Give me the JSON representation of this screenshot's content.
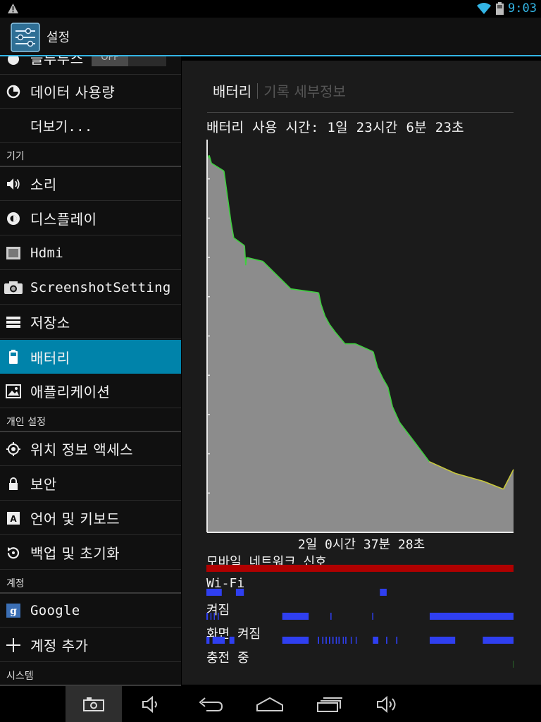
{
  "status_bar": {
    "time": "9:03"
  },
  "action_bar": {
    "title": "설정"
  },
  "sidebar": {
    "partial_item": {
      "label": "블루투스",
      "toggle_state": "OFF"
    },
    "items_top": [
      {
        "label": "데이터 사용량",
        "icon": "data-usage-icon"
      },
      {
        "label": "더보기...",
        "icon": ""
      }
    ],
    "header_device": "기기",
    "items_device": [
      {
        "label": "소리",
        "icon": "sound-icon"
      },
      {
        "label": "디스플레이",
        "icon": "display-icon"
      },
      {
        "label": "Hdmi",
        "icon": "hdmi-icon"
      },
      {
        "label": "ScreenshotSetting",
        "icon": "camera-icon"
      },
      {
        "label": "저장소",
        "icon": "storage-icon"
      },
      {
        "label": "배터리",
        "icon": "battery-icon",
        "active": true
      },
      {
        "label": "애플리케이션",
        "icon": "apps-icon"
      }
    ],
    "header_personal": "개인 설정",
    "items_personal": [
      {
        "label": "위치 정보 액세스",
        "icon": "location-icon"
      },
      {
        "label": "보안",
        "icon": "lock-icon"
      },
      {
        "label": "언어 및 키보드",
        "icon": "language-icon"
      },
      {
        "label": "백업 및 초기화",
        "icon": "backup-icon"
      }
    ],
    "header_account": "계정",
    "items_account": [
      {
        "label": "Google",
        "icon": "google-icon"
      },
      {
        "label": "계정 추가",
        "icon": "add-icon"
      }
    ],
    "header_system": "시스템"
  },
  "detail": {
    "tab_active": "배터리",
    "tab_inactive": "기록 세부정보",
    "usage_time": "배터리 사용 시간: 1일 23시간 6분 23초",
    "duration": "2일 0시간 37분 28초",
    "tracks": {
      "mobile_signal": "모바일 네트워크 신호",
      "wifi": "Wi-Fi",
      "gps": "켜짐",
      "screen_on": "화면 켜짐",
      "charging": "충전 중"
    }
  },
  "colors": {
    "accent": "#33b5e5",
    "selected_item": "#0083aa",
    "chart_fill": "#8c8c8c",
    "line_green": "#3fcf3f",
    "line_yellow": "#c8c83c",
    "signal_bar": "#b00000",
    "track_blue": "#2f3ff0"
  },
  "chart_data": {
    "type": "area",
    "title": "",
    "xlabel": "",
    "ylabel": "",
    "x_unit": "fraction of elapsed time (2일 0시간 37분 28초)",
    "y_unit": "battery percent",
    "ylim": [
      0,
      100
    ],
    "grid": false,
    "series": [
      {
        "x": [
          0,
          0.007,
          0.014,
          0.055,
          0.078,
          0.087,
          0.122,
          0.126,
          0.129,
          0.182,
          0.273,
          0.364,
          0.372,
          0.385,
          0.399,
          0.418,
          0.45,
          0.484,
          0.542,
          0.556,
          0.575,
          0.59,
          0.605,
          0.628,
          0.677,
          0.725,
          0.81,
          0.902,
          0.967,
          1.0
        ],
        "y": [
          95,
          96,
          94,
          92,
          79,
          75,
          73,
          68,
          70,
          69,
          62,
          61,
          58,
          55,
          53,
          51,
          48,
          48,
          46,
          42,
          39,
          37,
          32,
          28,
          23,
          18,
          15,
          13,
          11,
          16
        ]
      }
    ]
  },
  "tracks_data": {
    "signal": [
      [
        0,
        1
      ]
    ],
    "wifi": [
      [
        0.0,
        0.05
      ],
      [
        0.096,
        0.122
      ],
      [
        0.565,
        0.587
      ]
    ],
    "gps_on": [
      [
        0.0,
        0.005
      ],
      [
        0.013,
        0.014
      ],
      [
        0.024,
        0.026
      ],
      [
        0.037,
        0.039
      ],
      [
        0.247,
        0.333
      ],
      [
        0.404,
        0.407
      ],
      [
        0.54,
        0.542
      ],
      [
        0.729,
        0.73
      ],
      [
        0.727,
        1.0
      ]
    ],
    "screen_on": [
      [
        0.0,
        0.01
      ],
      [
        0.02,
        0.06
      ],
      [
        0.075,
        0.091
      ],
      [
        0.247,
        0.333
      ],
      [
        0.363,
        0.367
      ],
      [
        0.377,
        0.381
      ],
      [
        0.388,
        0.392
      ],
      [
        0.399,
        0.403
      ],
      [
        0.41,
        0.414
      ],
      [
        0.421,
        0.425
      ],
      [
        0.43,
        0.434
      ],
      [
        0.444,
        0.447
      ],
      [
        0.452,
        0.456
      ],
      [
        0.47,
        0.473
      ],
      [
        0.486,
        0.489
      ],
      [
        0.542,
        0.56
      ],
      [
        0.585,
        0.589
      ],
      [
        0.618,
        0.622
      ],
      [
        0.727,
        0.81
      ],
      [
        0.9,
        1.0
      ]
    ],
    "charging": [
      [
        0.999,
        1.0
      ]
    ]
  }
}
